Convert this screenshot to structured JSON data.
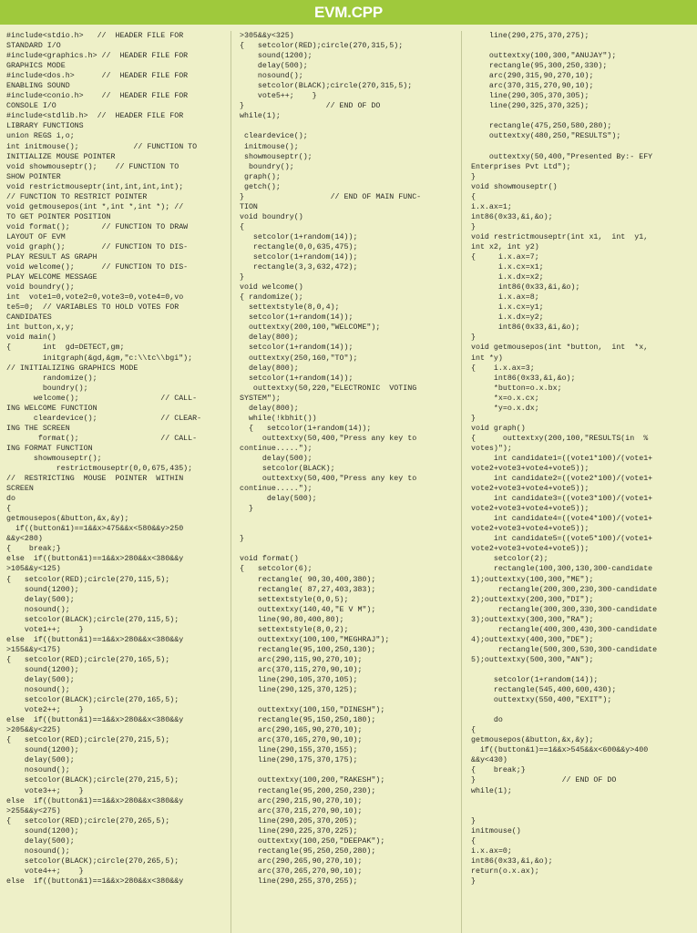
{
  "header": {
    "title": "EVM.CPP"
  },
  "accent_color": "#9fc93c",
  "background_color": "#eef0c8",
  "text_color": "#2b2b26",
  "divider_color": "#c3c79a",
  "columns": [
    {
      "id": "column-1",
      "code": "#include<stdio.h>   //  HEADER FILE FOR\nSTANDARD I/O\n#include<graphics.h> //  HEADER FILE FOR\nGRAPHICS MODE\n#include<dos.h>      //  HEADER FILE FOR\nENABLING SOUND\n#include<conio.h>    //  HEADER FILE FOR\nCONSOLE I/O\n#include<stdlib.h>  //  HEADER FILE FOR\nLIBRARY FUNCTIONS\nunion REGS i,o;\nint initmouse();            // FUNCTION TO\nINITIALIZE MOUSE POINTER\nvoid showmouseptr();    // FUNCTION TO\nSHOW POINTER\nvoid restrictmouseptr(int,int,int,int);\n// FUNCTION TO RESTRICT POINTER\nvoid getmousepos(int *,int *,int *); //\nTO GET POINTER POSITION\nvoid format();       // FUNCTION TO DRAW\nLAYOUT OF EVM\nvoid graph();        // FUNCTION TO DIS-\nPLAY RESULT AS GRAPH\nvoid welcome();      // FUNCTION TO DIS-\nPLAY WELCOME MESSAGE\nvoid boundry();\nint  vote1=0,vote2=0,vote3=0,vote4=0,vo\nte5=0;  // VARIABLES TO HOLD VOTES FOR\nCANDIDATES\nint button,x,y;\nvoid main()\n{       int  gd=DETECT,gm;\n        initgraph(&gd,&gm,\"c:\\\\tc\\\\bgi\");\n// INITIALIZING GRAPHICS MODE\n        randomize();\n        boundry();\n      welcome();                  // CALL-\nING WELCOME FUNCTION\n      cleardevice();              // CLEAR-\nING THE SCREEN\n       format();                  // CALL-\nING FORMAT FUNCTION\n      showmouseptr();\n           restrictmouseptr(0,0,675,435);\n//  RESTRICTING  MOUSE  POINTER  WITHIN\nSCREEN\ndo\n{\ngetmousepos(&button,&x,&y);\n  if((button&1)==1&&x>475&&x<580&&y>250\n&&y<280)\n{    break;}\nelse  if((button&1)==1&&x>280&&x<380&&y\n>105&&y<125)\n{   setcolor(RED);circle(270,115,5);\n    sound(1200);\n    delay(500);\n    nosound();\n    setcolor(BLACK);circle(270,115,5);\n    vote1++;    }\nelse  if((button&1)==1&&x>280&&x<380&&y\n>155&&y<175)\n{   setcolor(RED);circle(270,165,5);\n    sound(1200);\n    delay(500);\n    nosound();\n    setcolor(BLACK);circle(270,165,5);\n    vote2++;    }\nelse  if((button&1)==1&&x>280&&x<380&&y\n>205&&y<225)\n{   setcolor(RED);circle(270,215,5);\n    sound(1200);\n    delay(500);\n    nosound();\n    setcolor(BLACK);circle(270,215,5);\n    vote3++;    }\nelse  if((button&1)==1&&x>280&&x<380&&y\n>255&&y<275)\n{   setcolor(RED);circle(270,265,5);\n    sound(1200);\n    delay(500);\n    nosound();\n    setcolor(BLACK);circle(270,265,5);\n    vote4++;    }\nelse  if((button&1)==1&&x>280&&x<380&&y"
    },
    {
      "id": "column-2",
      "code": ">305&&y<325)\n{   setcolor(RED);circle(270,315,5);\n    sound(1200);\n    delay(500);\n    nosound();\n    setcolor(BLACK);circle(270,315,5);\n    vote5++;    }\n}                  // END OF DO\nwhile(1);\n\n cleardevice();\n initmouse();\n showmouseptr();\n  boundry();\n graph();\n getch();\n}                   // END OF MAIN FUNC-\nTION\nvoid boundry()\n{\n   setcolor(1+random(14));\n   rectangle(0,0,635,475);\n   setcolor(1+random(14));\n   rectangle(3,3,632,472);\n}\nvoid welcome()\n{ randomize();\n  settextstyle(8,0,4);\n  setcolor(1+random(14));\n  outtextxy(200,100,\"WELCOME\");\n  delay(800);\n  setcolor(1+random(14));\n  outtextxy(250,160,\"TO\");\n  delay(800);\n  setcolor(1+random(14));\n   outtextxy(50,220,\"ELECTRONIC  VOTING\nSYSTEM\");\n  delay(800);\n  while(!kbhit())\n  {   setcolor(1+random(14));\n     outtextxy(50,400,\"Press any key to\ncontinue.....\");\n     delay(500);\n     setcolor(BLACK);\n     outtextxy(50,400,\"Press any key to\ncontinue.....\");\n      delay(500);\n  }\n\n\n}\n\nvoid format()\n{   setcolor(6);\n    rectangle( 90,30,400,380);\n    rectangle( 87,27,403,383);\n    settextstyle(0,0,5);\n    outtextxy(140,40,\"E V M\");\n    line(90,80,400,80);\n    settextstyle(8,0,2);\n    outtextxy(100,100,\"MEGHRAJ\");\n    rectangle(95,100,250,130);\n    arc(290,115,90,270,10);\n    arc(370,115,270,90,10);\n    line(290,105,370,105);\n    line(290,125,370,125);\n\n    outtextxy(100,150,\"DINESH\");\n    rectangle(95,150,250,180);\n    arc(290,165,90,270,10);\n    arc(370,165,270,90,10);\n    line(290,155,370,155);\n    line(290,175,370,175);\n\n    outtextxy(100,200,\"RAKESH\");\n    rectangle(95,200,250,230);\n    arc(290,215,90,270,10);\n    arc(370,215,270,90,10);\n    line(290,205,370,205);\n    line(290,225,370,225);\n    outtextxy(100,250,\"DEEPAK\");\n    rectangle(95,250,250,280);\n    arc(290,265,90,270,10);\n    arc(370,265,270,90,10);\n    line(290,255,370,255);"
    },
    {
      "id": "column-3",
      "code": "    line(290,275,370,275);\n\n    outtextxy(100,300,\"ANUJAY\");\n    rectangle(95,300,250,330);\n    arc(290,315,90,270,10);\n    arc(370,315,270,90,10);\n    line(290,305,370,305);\n    line(290,325,370,325);\n\n    rectangle(475,250,580,280);\n    outtextxy(480,250,\"RESULTS\");\n\n    outtextxy(50,400,\"Presented By:- EFY\nEnterprises Pvt Ltd\");\n}\nvoid showmouseptr()\n{\ni.x.ax=1;\nint86(0x33,&i,&o);\n}\nvoid restrictmouseptr(int x1,  int  y1,\nint x2, int y2)\n{     i.x.ax=7;\n      i.x.cx=x1;\n      i.x.dx=x2;\n      int86(0x33,&i,&o);\n      i.x.ax=8;\n      i.x.cx=y1;\n      i.x.dx=y2;\n      int86(0x33,&i,&o);\n}\nvoid getmousepos(int *button,  int  *x,\nint *y)\n{    i.x.ax=3;\n     int86(0x33,&i,&o);\n     *button=o.x.bx;\n     *x=o.x.cx;\n     *y=o.x.dx;\n}\nvoid graph()\n{      outtextxy(200,100,\"RESULTS(in  %\nvotes)\");\n     int candidate1=((vote1*100)/(vote1+\nvote2+vote3+vote4+vote5));\n     int candidate2=((vote2*100)/(vote1+\nvote2+vote3+vote4+vote5));\n     int candidate3=((vote3*100)/(vote1+\nvote2+vote3+vote4+vote5));\n     int candidate4=((vote4*100)/(vote1+\nvote2+vote3+vote4+vote5));\n     int candidate5=((vote5*100)/(vote1+\nvote2+vote3+vote4+vote5));\n     setcolor(2);\n     rectangle(100,300,130,300-candidate\n1);outtextxy(100,300,\"ME\");\n      rectangle(200,300,230,300-candidate\n2);outtextxy(200,300,\"DI\");\n      rectangle(300,300,330,300-candidate\n3);outtextxy(300,300,\"RA\");\n      rectangle(400,300,430,300-candidate\n4);outtextxy(400,300,\"DE\");\n      rectangle(500,300,530,300-candidate\n5);outtextxy(500,300,\"AN\");\n\n     setcolor(1+random(14));\n     rectangle(545,400,600,430);\n     outtextxy(550,400,\"EXIT\");\n\n     do\n{\ngetmousepos(&button,&x,&y);\n  if((button&1)==1&&x>545&&x<600&&y>400\n&&y<430)\n{    break;}\n}                   // END OF DO\nwhile(1);\n\n\n}\ninitmouse()\n{\ni.x.ax=0;\nint86(0x33,&i,&o);\nreturn(o.x.ax);\n}"
    }
  ]
}
